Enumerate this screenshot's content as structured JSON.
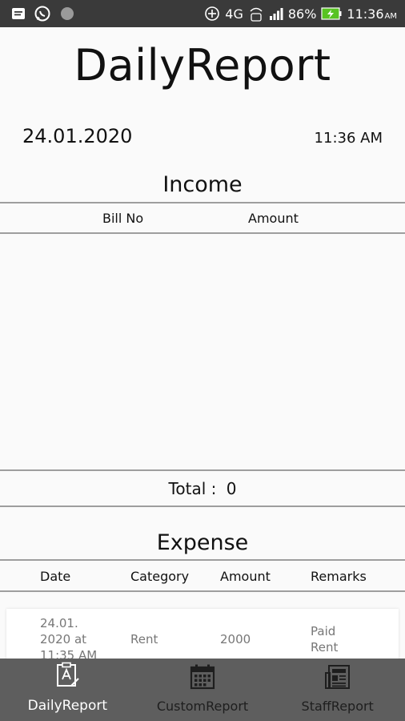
{
  "status_bar": {
    "network": "4G",
    "network_sub": "Vo LTE",
    "battery": "86%",
    "time": "11:36",
    "ampm": "AM"
  },
  "header": {
    "title": "DailyReport",
    "date": "24.01.2020",
    "time": "11:36 AM"
  },
  "income": {
    "title": "Income",
    "columns": [
      "Bill No",
      "Amount"
    ],
    "total_label": "Total :",
    "total_value": "0"
  },
  "expense": {
    "title": "Expense",
    "columns": [
      "Date",
      "Category",
      "Amount",
      "Remarks"
    ],
    "rows": [
      {
        "date_lines": [
          "24.01.",
          "2020 at",
          "11:35 AM"
        ],
        "category": "Rent",
        "amount": "2000",
        "remarks_lines": [
          "Paid",
          "Rent"
        ]
      }
    ]
  },
  "bottom_nav": {
    "items": [
      {
        "label": "DailyReport",
        "icon": "report-icon",
        "active": true
      },
      {
        "label": "CustomReport",
        "icon": "calendar-icon",
        "active": false
      },
      {
        "label": "StaffReport",
        "icon": "newspaper-icon",
        "active": false
      }
    ]
  }
}
